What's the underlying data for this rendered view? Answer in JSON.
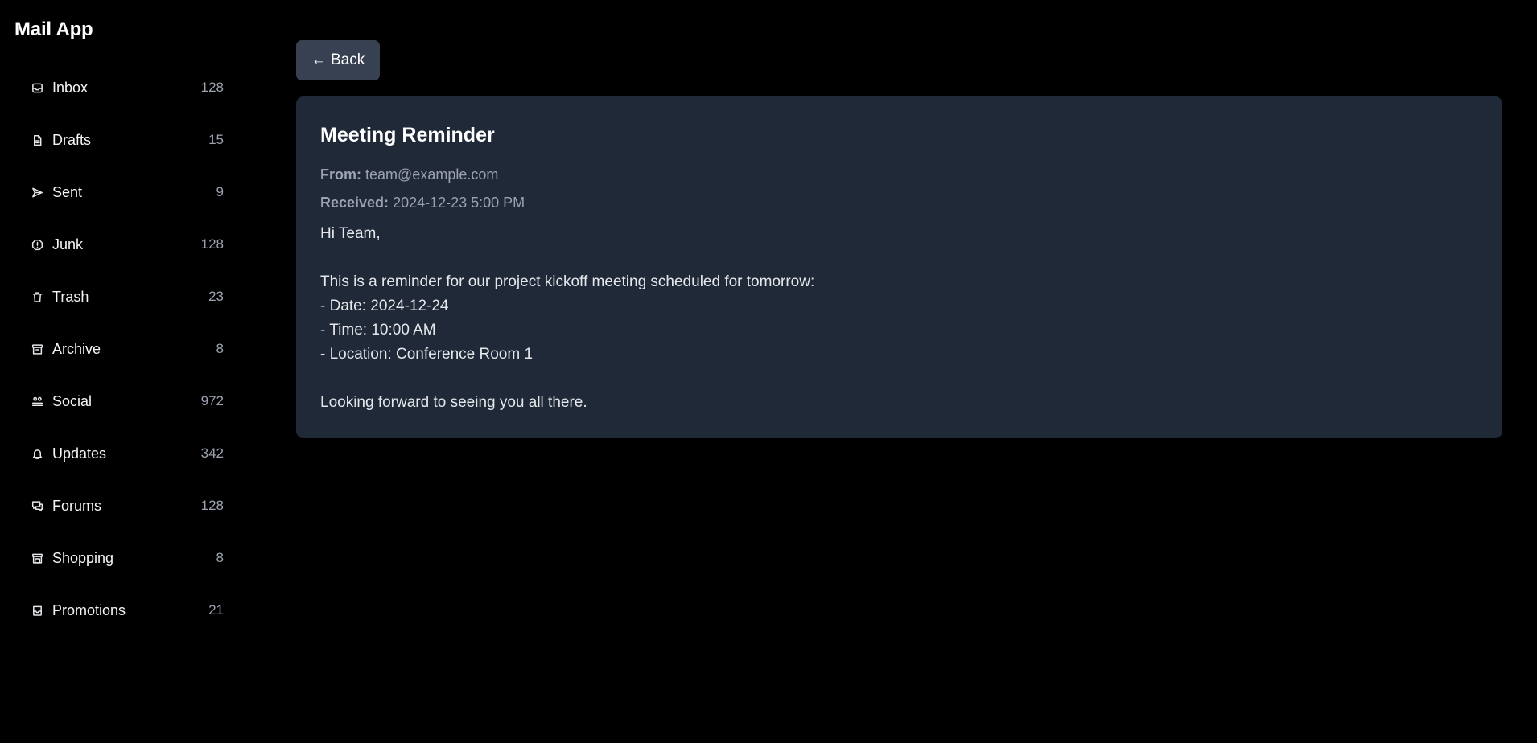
{
  "app": {
    "title": "Mail App"
  },
  "sidebar": {
    "items": [
      {
        "label": "Inbox",
        "count": "128",
        "icon": "inbox-icon"
      },
      {
        "label": "Drafts",
        "count": "15",
        "icon": "file-icon"
      },
      {
        "label": "Sent",
        "count": "9",
        "icon": "send-icon"
      },
      {
        "label": "Junk",
        "count": "128",
        "icon": "alert-icon"
      },
      {
        "label": "Trash",
        "count": "23",
        "icon": "trash-icon"
      },
      {
        "label": "Archive",
        "count": "8",
        "icon": "archive-icon"
      },
      {
        "label": "Social",
        "count": "972",
        "icon": "users-icon"
      },
      {
        "label": "Updates",
        "count": "342",
        "icon": "bell-icon"
      },
      {
        "label": "Forums",
        "count": "128",
        "icon": "messages-icon"
      },
      {
        "label": "Shopping",
        "count": "8",
        "icon": "store-icon"
      },
      {
        "label": "Promotions",
        "count": "21",
        "icon": "tag-icon"
      }
    ]
  },
  "main": {
    "back_label": "← Back",
    "email": {
      "subject": "Meeting Reminder",
      "from_label": "From:",
      "from_value": "team@example.com",
      "received_label": "Received:",
      "received_value": "2024-12-23 5:00 PM",
      "body_lines": [
        "Hi Team,",
        "",
        "This is a reminder for our project kickoff meeting scheduled for tomorrow:",
        "- Date: 2024-12-24",
        "- Time: 10:00 AM",
        "- Location: Conference Room 1",
        "",
        "Looking forward to seeing you all there."
      ]
    }
  },
  "colors": {
    "background": "#000000",
    "card": "#1f2937",
    "button": "#374151",
    "muted_text": "#9ca3af"
  }
}
